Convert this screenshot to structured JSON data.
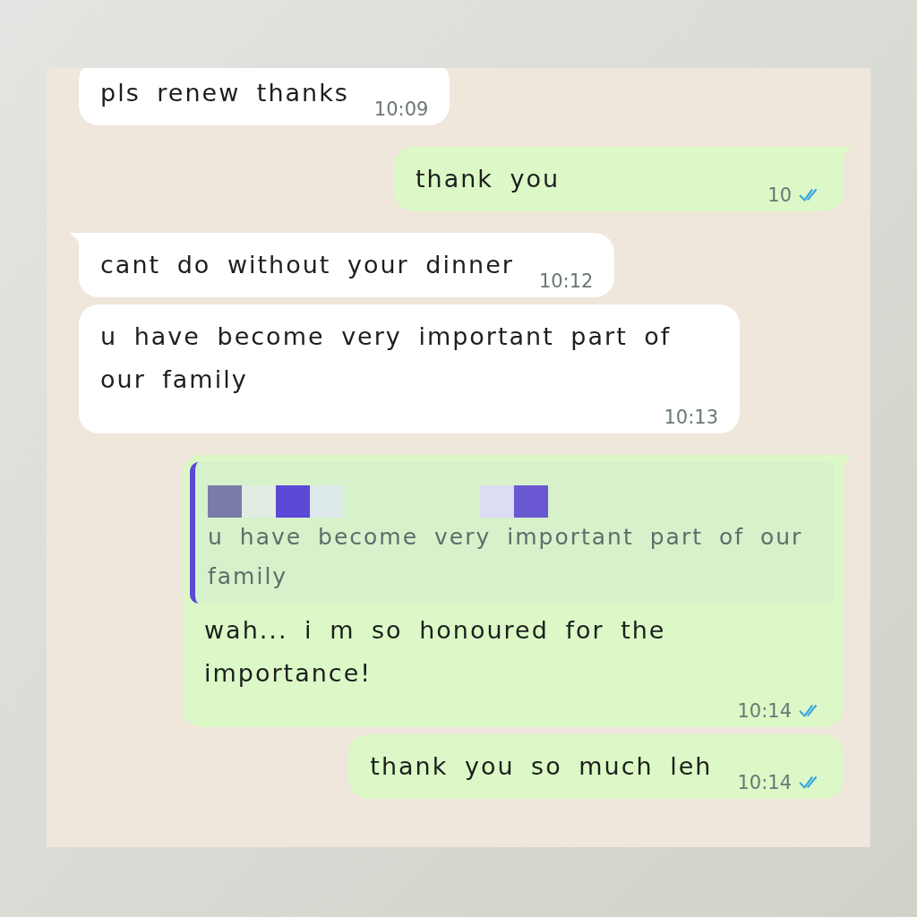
{
  "messages": [
    {
      "kind": "incoming",
      "tail": false,
      "text": "pls renew thanks",
      "time": "10:09"
    },
    {
      "kind": "outgoing",
      "tail": true,
      "text": "thank you",
      "time": "10",
      "read": true
    },
    {
      "kind": "incoming",
      "tail": true,
      "text": "cant do without your dinner",
      "time": "10:12"
    },
    {
      "kind": "incoming",
      "tail": false,
      "text": "u have become very important part of our family",
      "time": "10:13"
    },
    {
      "kind": "outgoing",
      "tail": true,
      "quote": {
        "text": "u have become very important part of our family"
      },
      "text": "wah... i m so honoured for the importance!",
      "time": "10:14",
      "read": true
    },
    {
      "kind": "outgoing",
      "tail": false,
      "text": "thank you so much leh",
      "time": "10:14",
      "read": true
    }
  ]
}
